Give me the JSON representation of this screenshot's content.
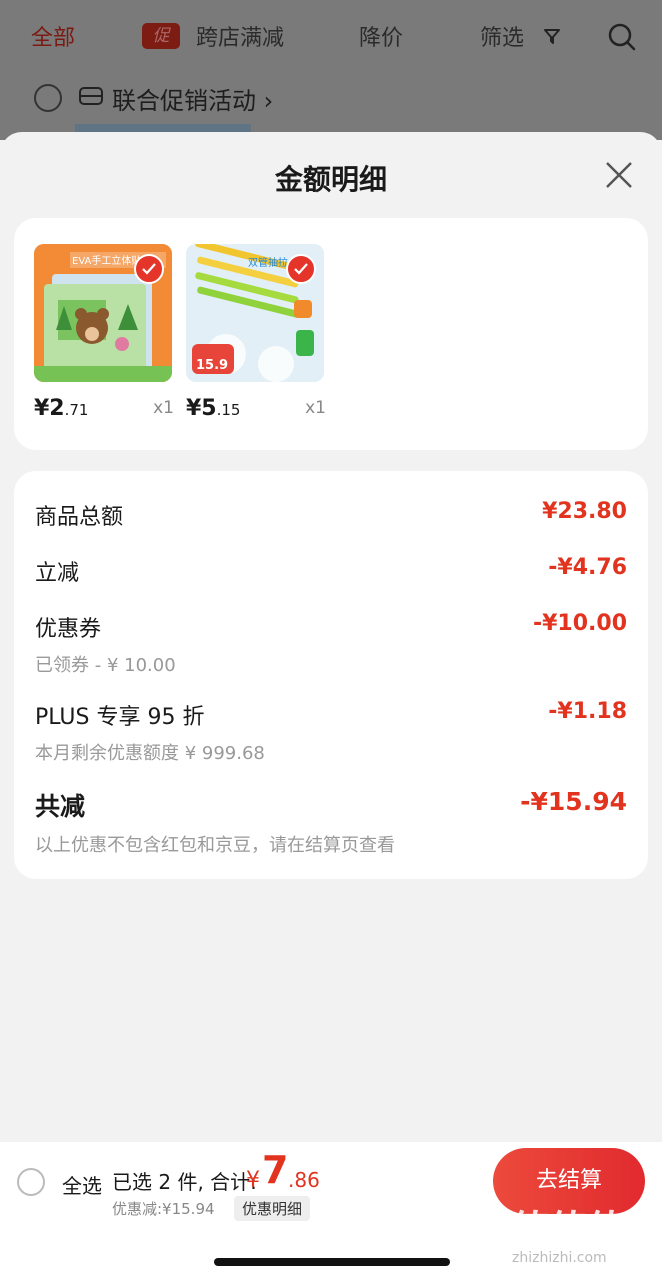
{
  "filter_bar": {
    "tab_all": "全部",
    "promo_badge": "促",
    "tab_cross_store": "跨店满减",
    "tab_price_drop": "降价",
    "tab_filter": "筛选"
  },
  "union_promo": {
    "label": "联合促销活动 ›"
  },
  "sheet": {
    "title": "金额明细",
    "products": [
      {
        "image_text": "EVA手工立体贴画",
        "price_int": "¥2",
        "price_dec": ".71",
        "qty": "x1"
      },
      {
        "image_text": "双管抽拉水枪",
        "badge_price": "15.9",
        "price_int": "¥5",
        "price_dec": ".15",
        "qty": "x1"
      }
    ],
    "amount": {
      "goods_total_label": "商品总额",
      "goods_total_value": "¥23.80",
      "instant_label": "立减",
      "instant_value": "-¥4.76",
      "coupon_label": "优惠券",
      "coupon_value": "-¥10.00",
      "coupon_sub": "已领券 - ¥ 10.00",
      "plus_label": "PLUS 专享 95 折",
      "plus_value": "-¥1.18",
      "plus_sub": "本月剩余优惠额度 ¥ 999.68",
      "total_label": "共减",
      "total_value": "-¥15.94",
      "note": "以上优惠不包含红包和京豆，请在结算页查看"
    }
  },
  "bottom_bar": {
    "select_all": "全选",
    "selected_text": "已选 2 件, 合计:",
    "currency": "¥",
    "total_int": "7",
    "total_dec": ".86",
    "discount_text": "优惠减:¥15.94",
    "detail_button": "优惠明细",
    "checkout_button": "去结算"
  },
  "watermark": {
    "main": "值值值",
    "sub": "zhizhizhi.com"
  },
  "colors": {
    "accent": "#e2331f",
    "checkout": "#e12a2e",
    "check": "#e5352b"
  }
}
